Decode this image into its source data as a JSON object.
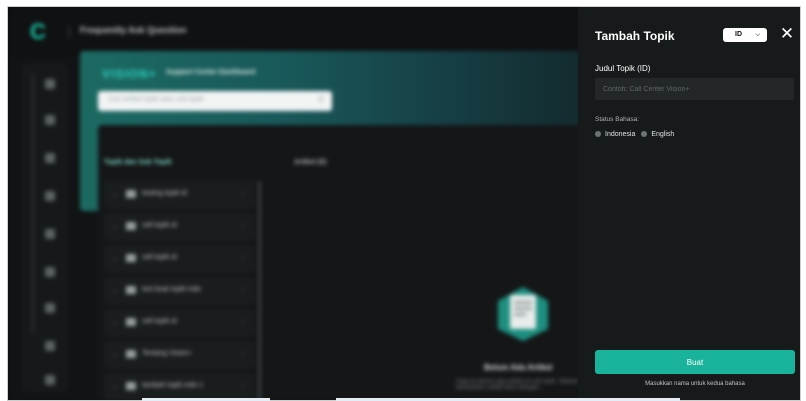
{
  "background_app": {
    "page_title": "Frequently Ask Question",
    "brand": "VISION+",
    "brand_subtitle": "Support Center Dashboard",
    "search_placeholder": "Cari artikel topik atau sub topik",
    "topics_header": "Topik dan Sub Topik",
    "articles_header": "Artikel (0)",
    "topics": [
      {
        "label": "testing topik id"
      },
      {
        "label": "cell topik id"
      },
      {
        "label": "cell topik id"
      },
      {
        "label": "test buat topik indo"
      },
      {
        "label": "cell topik id"
      },
      {
        "label": "Tentang Vision+"
      },
      {
        "label": "tambah topik indo 1"
      }
    ],
    "empty_title": "Belum Ada Artikel",
    "empty_desc": "Saat ini belum ada artikel di sub topik. Silakan tambahkan artikel baru dengan..."
  },
  "drawer": {
    "title": "Tambah Topik",
    "language_selected": "ID",
    "field_label": "Judul Topik (ID)",
    "field_value": "",
    "field_placeholder": "Contoh: Call Center Vision+",
    "status_label": "Status Bahasa:",
    "status_items": [
      {
        "label": "Indonesia"
      },
      {
        "label": "English"
      }
    ],
    "submit_label": "Buat",
    "hint": "Masukkan nama untuk kedua bahasa"
  },
  "colors": {
    "accent": "#19b39b",
    "drawer_bg": "#171a1b",
    "input_bg": "#232729",
    "status_dot": "#6b7375"
  },
  "icons": {
    "close": "close-icon",
    "chevron": "chevron-down-icon",
    "folder": "folder-icon",
    "search": "search-icon"
  }
}
